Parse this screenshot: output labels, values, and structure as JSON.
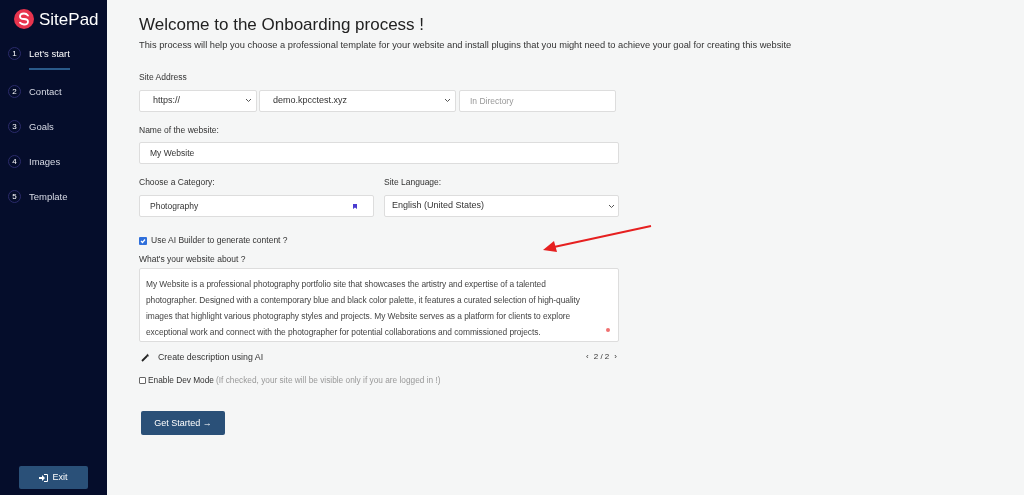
{
  "sidebar": {
    "logo": "SitePad",
    "steps": [
      {
        "number": "1",
        "label": "Let's start",
        "selected": true
      },
      {
        "number": "2",
        "label": "Contact",
        "selected": false
      },
      {
        "number": "3",
        "label": "Goals",
        "selected": false
      },
      {
        "number": "4",
        "label": "Images",
        "selected": false
      },
      {
        "number": "5",
        "label": "Template",
        "selected": false
      }
    ],
    "exit_button": "Exit"
  },
  "main": {
    "title": "Welcome to the Onboarding process !",
    "subtitle": "This process will help you choose a professional template for your website and install plugins that you might need to achieve your goal for creating this website",
    "site_address": {
      "label": "Site Address",
      "protocol": "https://",
      "domain": "demo.kpcctest.xyz",
      "directory": {
        "placeholder": "In Directory"
      }
    },
    "site_name": {
      "label": "Name of the website:",
      "value": "My Website"
    },
    "category": {
      "label": "Choose a Category:",
      "value": "Photography"
    },
    "language": {
      "label": "Site Language:",
      "value": "English (United States)"
    },
    "ai_builder": {
      "label": "Use AI Builder to generate content ?",
      "checked": true
    },
    "about": {
      "label": "What's your website about ?",
      "value": "My Website is a professional photography portfolio site that showcases the artistry and expertise of a talented photographer. Designed with a contemporary blue and black color palette, it features a curated selection of high-quality images that highlight various photography styles and projects. My Website serves as a platform for clients to explore exceptional work and connect with the photographer for potential collaborations and commissioned projects."
    },
    "create_description": "Create description using AI",
    "pager": {
      "prev": "‹",
      "page": "2 / 2",
      "next": "›"
    },
    "dev_mode": {
      "label": "Enable Dev Mode",
      "hint": "(If checked, your site will be visible only if you are logged in !)",
      "checked": false
    },
    "submit_button": "Get Started →"
  }
}
